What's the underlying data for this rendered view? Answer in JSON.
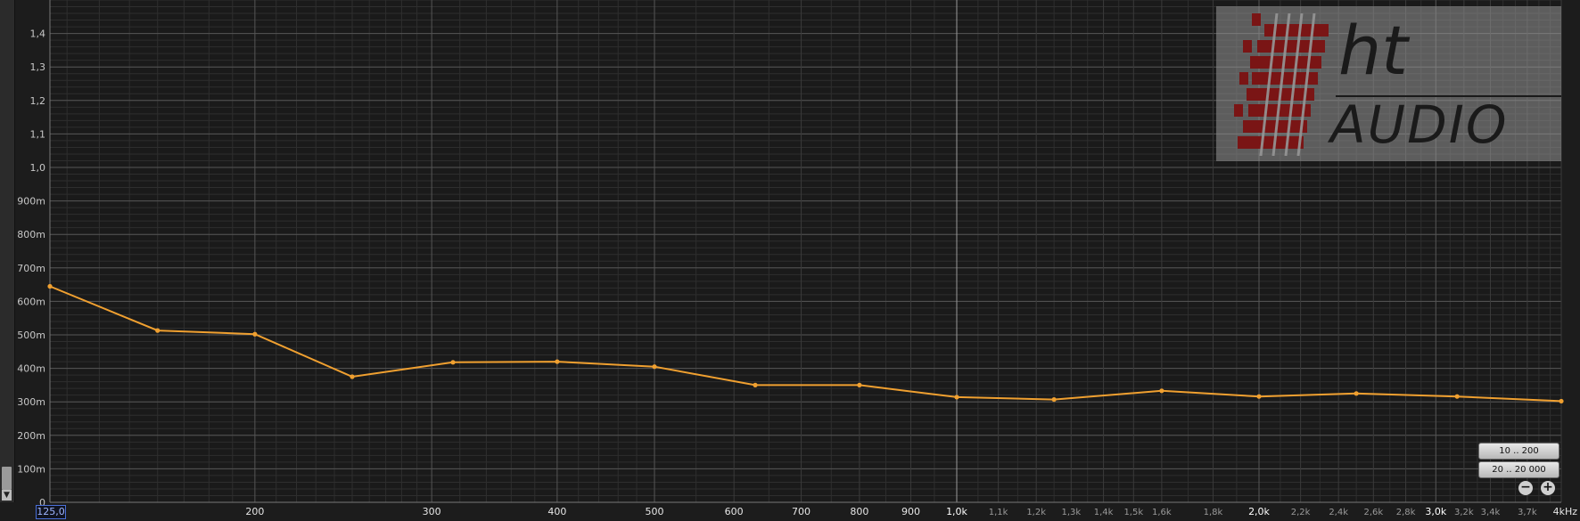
{
  "colors": {
    "line": "#f0a030",
    "background": "#1c1c1c",
    "grid_major": "#555555",
    "grid_minor": "#2e2e2e"
  },
  "chart_data": {
    "type": "line",
    "x_scale": "log",
    "xlim": [
      125,
      4000
    ],
    "ylim": [
      0,
      1.5
    ],
    "x": [
      125,
      160,
      200,
      250,
      315,
      400,
      500,
      630,
      800,
      1000,
      1250,
      1600,
      2000,
      2500,
      3150,
      4000
    ],
    "series": [
      {
        "values": [
          0.645,
          0.513,
          0.502,
          0.375,
          0.418,
          0.42,
          0.405,
          0.35,
          0.35,
          0.314,
          0.307,
          0.333,
          0.316,
          0.325,
          0.316,
          0.302
        ]
      }
    ],
    "yticks": [
      {
        "v": 0,
        "label": "0"
      },
      {
        "v": 0.1,
        "label": "100m"
      },
      {
        "v": 0.2,
        "label": "200m"
      },
      {
        "v": 0.3,
        "label": "300m"
      },
      {
        "v": 0.4,
        "label": "400m"
      },
      {
        "v": 0.5,
        "label": "500m"
      },
      {
        "v": 0.6,
        "label": "600m"
      },
      {
        "v": 0.7,
        "label": "700m"
      },
      {
        "v": 0.8,
        "label": "800m"
      },
      {
        "v": 0.9,
        "label": "900m"
      },
      {
        "v": 1.0,
        "label": "1,0"
      },
      {
        "v": 1.1,
        "label": "1,1"
      },
      {
        "v": 1.2,
        "label": "1,2"
      },
      {
        "v": 1.3,
        "label": "1,3"
      },
      {
        "v": 1.4,
        "label": "1,4"
      }
    ],
    "xticks": [
      {
        "v": 200,
        "label": "200",
        "kind": "normal"
      },
      {
        "v": 300,
        "label": "300",
        "kind": "normal"
      },
      {
        "v": 400,
        "label": "400",
        "kind": "normal"
      },
      {
        "v": 500,
        "label": "500",
        "kind": "normal"
      },
      {
        "v": 600,
        "label": "600",
        "kind": "normal"
      },
      {
        "v": 700,
        "label": "700",
        "kind": "normal"
      },
      {
        "v": 800,
        "label": "800",
        "kind": "normal"
      },
      {
        "v": 900,
        "label": "900",
        "kind": "normal"
      },
      {
        "v": 1000,
        "label": "1,0k",
        "kind": "major"
      },
      {
        "v": 1100,
        "label": "1,1k",
        "kind": "minor"
      },
      {
        "v": 1200,
        "label": "1,2k",
        "kind": "minor"
      },
      {
        "v": 1300,
        "label": "1,3k",
        "kind": "minor"
      },
      {
        "v": 1400,
        "label": "1,4k",
        "kind": "minor"
      },
      {
        "v": 1500,
        "label": "1,5k",
        "kind": "minor"
      },
      {
        "v": 1600,
        "label": "1,6k",
        "kind": "minor"
      },
      {
        "v": 1800,
        "label": "1,8k",
        "kind": "minor"
      },
      {
        "v": 2000,
        "label": "2,0k",
        "kind": "major"
      },
      {
        "v": 2200,
        "label": "2,2k",
        "kind": "minor"
      },
      {
        "v": 2400,
        "label": "2,4k",
        "kind": "minor"
      },
      {
        "v": 2600,
        "label": "2,6k",
        "kind": "minor"
      },
      {
        "v": 2800,
        "label": "2,8k",
        "kind": "minor"
      },
      {
        "v": 3000,
        "label": "3,0k",
        "kind": "major"
      },
      {
        "v": 3200,
        "label": "3,2k",
        "kind": "minor"
      },
      {
        "v": 3400,
        "label": "3,4k",
        "kind": "minor"
      },
      {
        "v": 3700,
        "label": "3,7k",
        "kind": "minor"
      },
      {
        "v": 4000,
        "label": "4kHz",
        "kind": "normal"
      }
    ],
    "grid": true
  },
  "controls": {
    "start_value": "125,0",
    "range_low": "10 .. 200",
    "range_full": "20 .. 20 000",
    "zoom_out": "−",
    "zoom_in": "+"
  },
  "logo": {
    "text_top": "ht",
    "text_bottom": "AUDIO"
  }
}
